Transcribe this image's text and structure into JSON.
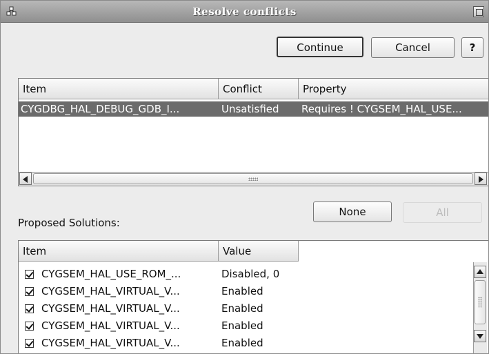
{
  "window": {
    "title": "Resolve conflicts"
  },
  "toolbar": {
    "continue_label": "Continue",
    "cancel_label": "Cancel",
    "help_label": "?"
  },
  "conflicts": {
    "columns": [
      "Item",
      "Conflict",
      "Property"
    ],
    "rows": [
      {
        "item": "CYGDBG_HAL_DEBUG_GDB_I...",
        "conflict": "Unsatisfied",
        "property": "Requires ! CYGSEM_HAL_USE..."
      }
    ]
  },
  "solutions": {
    "label": "Proposed Solutions:",
    "none_label": "None",
    "all_label": "All",
    "columns": [
      "Item",
      "Value"
    ],
    "rows": [
      {
        "item": "CYGSEM_HAL_USE_ROM_...",
        "value": "Disabled, 0",
        "checked": true
      },
      {
        "item": "CYGSEM_HAL_VIRTUAL_V...",
        "value": "Enabled",
        "checked": true
      },
      {
        "item": "CYGSEM_HAL_VIRTUAL_V...",
        "value": "Enabled",
        "checked": true
      },
      {
        "item": "CYGSEM_HAL_VIRTUAL_V...",
        "value": "Enabled",
        "checked": true
      },
      {
        "item": "CYGSEM_HAL_VIRTUAL_V...",
        "value": "Enabled",
        "checked": true
      }
    ]
  },
  "colors": {
    "selection": "#6b6b6b",
    "titlebar": "#a4a4a4",
    "dialog_bg": "#ececec"
  }
}
